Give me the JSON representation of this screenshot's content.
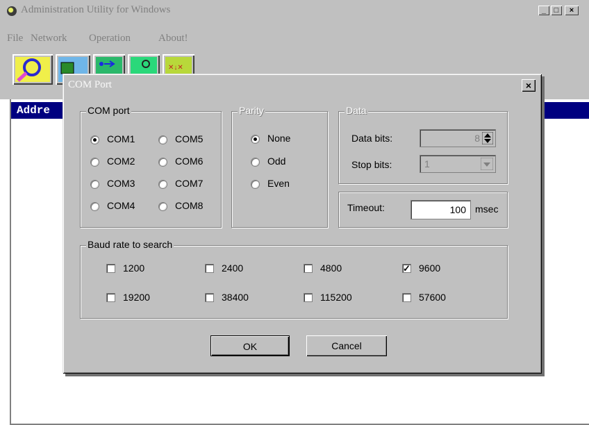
{
  "window": {
    "title": "Administration Utility for Windows",
    "minimize": "_",
    "maximize": "□",
    "close": "×"
  },
  "menu": [
    "File",
    "Network",
    "Operation",
    "About!"
  ],
  "list": {
    "header": "Addre"
  },
  "dialog": {
    "title": "COM Port",
    "close": "×",
    "com_port": {
      "label": "COM port",
      "options": [
        "COM1",
        "COM2",
        "COM3",
        "COM4",
        "COM5",
        "COM6",
        "COM7",
        "COM8"
      ],
      "selected": "COM1"
    },
    "parity": {
      "label": "Parity",
      "options": [
        "None",
        "Odd",
        "Even"
      ],
      "selected": "None"
    },
    "data": {
      "label": "Data",
      "data_bits_label": "Data bits:",
      "data_bits_value": "8",
      "stop_bits_label": "Stop bits:",
      "stop_bits_value": "1"
    },
    "timeout": {
      "label": "Timeout:",
      "value": "100",
      "unit": "msec"
    },
    "baud": {
      "label": "Baud rate to search",
      "options": [
        "1200",
        "2400",
        "4800",
        "9600",
        "19200",
        "38400",
        "115200",
        "57600"
      ],
      "checked": [
        "9600"
      ]
    },
    "ok_label": "OK",
    "cancel_label": "Cancel"
  },
  "colors": {
    "list_header": "#000080",
    "face": "#c0c0c0"
  }
}
